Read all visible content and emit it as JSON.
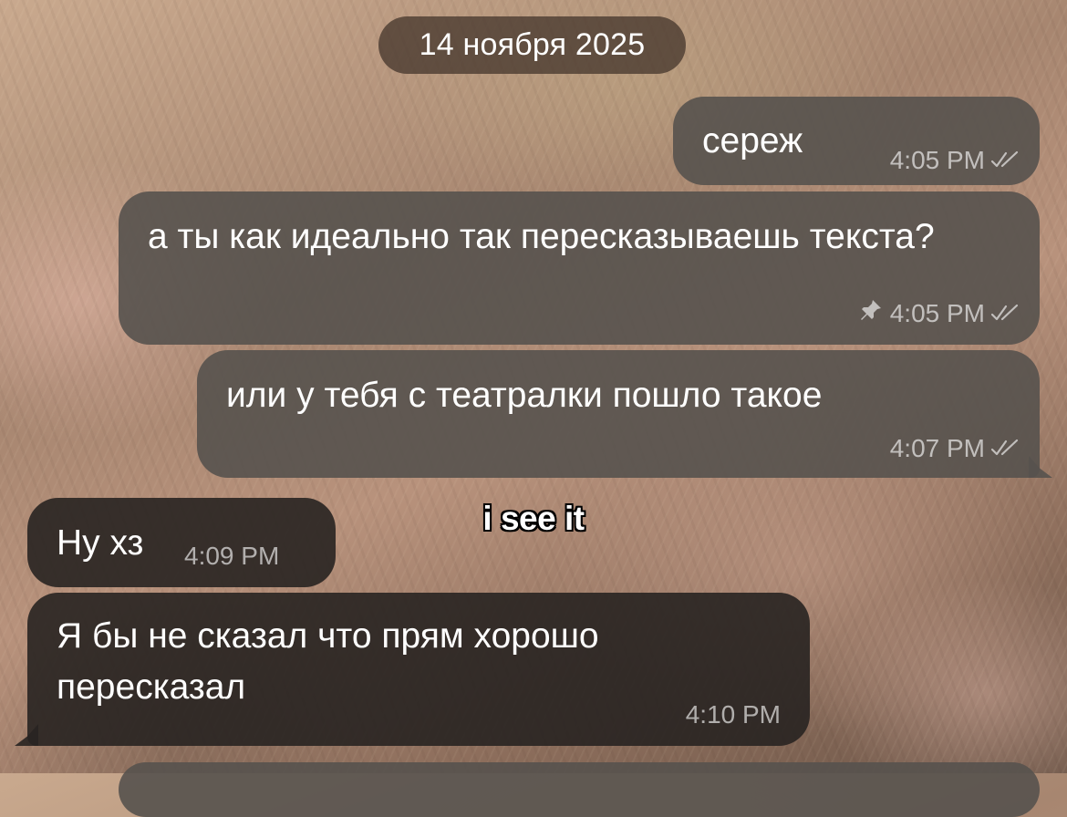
{
  "date_separator": "14 ноября 2025",
  "messages": [
    {
      "direction": "outgoing",
      "text": "сереж",
      "time": "4:05 PM",
      "status_icon": "double-check-icon",
      "pinned": false
    },
    {
      "direction": "outgoing",
      "text": "а ты как идеально так пересказываешь текста?",
      "time": "4:05 PM",
      "status_icon": "double-check-icon",
      "pinned": true,
      "pin_icon": "pin-icon"
    },
    {
      "direction": "outgoing",
      "text": "или у тебя с театралки пошло такое",
      "time": "4:07 PM",
      "status_icon": "double-check-icon",
      "pinned": false
    },
    {
      "direction": "incoming",
      "text": "Ну хз",
      "time": "4:09 PM"
    },
    {
      "direction": "incoming",
      "text": "Я бы не сказал что прям хорошо пересказал",
      "time": "4:10 PM"
    }
  ],
  "overlay_caption": "i see it",
  "colors": {
    "outgoing_bubble": "#56524e",
    "incoming_bubble": "#282421",
    "date_pill": "#48382e",
    "meta_text": "#bdbcbb",
    "text": "#ffffff"
  }
}
